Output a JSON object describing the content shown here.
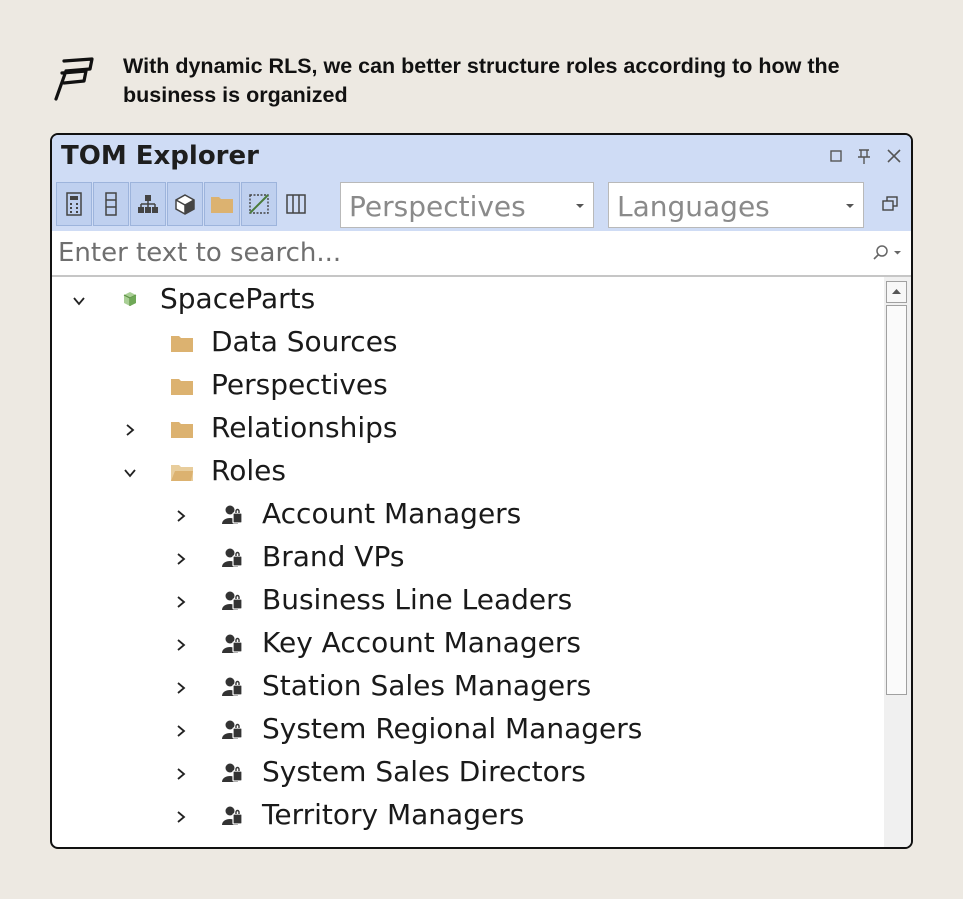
{
  "caption": "With dynamic RLS, we can better structure roles according to how the business is organized",
  "window": {
    "title": "TOM Explorer",
    "controls": [
      "maximize-icon",
      "pin-icon",
      "close-icon"
    ]
  },
  "toolbar": {
    "buttons": [
      "calculator-icon",
      "column-icon",
      "hierarchy-icon",
      "cube-icon",
      "folder-icon",
      "hidden-icon",
      "columns-icon"
    ],
    "perspectives": "Perspectives",
    "languages": "Languages",
    "window_icon": "window-copy-icon"
  },
  "search": {
    "placeholder": "Enter text to search...",
    "icon": "search-icon"
  },
  "tree": {
    "model": {
      "label": "SpaceParts",
      "icon": "model-icon",
      "expanded": true
    },
    "folders": [
      {
        "label": "Data Sources",
        "icon": "folder-icon",
        "expanded": false
      },
      {
        "label": "Perspectives",
        "icon": "folder-icon",
        "expanded": false
      },
      {
        "label": "Relationships",
        "icon": "folder-icon",
        "expanded": false
      },
      {
        "label": "Roles",
        "icon": "folder-open-icon",
        "expanded": true
      }
    ],
    "roles": [
      {
        "label": "Account Managers",
        "icon": "role-icon"
      },
      {
        "label": "Brand VPs",
        "icon": "role-icon"
      },
      {
        "label": "Business Line Leaders",
        "icon": "role-icon"
      },
      {
        "label": "Key Account Managers",
        "icon": "role-icon"
      },
      {
        "label": "Station Sales Managers",
        "icon": "role-icon"
      },
      {
        "label": "System Regional Managers",
        "icon": "role-icon"
      },
      {
        "label": "System Sales Directors",
        "icon": "role-icon"
      },
      {
        "label": "Territory Managers",
        "icon": "role-icon"
      }
    ]
  },
  "colors": {
    "titlebar": "#cfdcf5",
    "folder": "#dcb270",
    "background": "#ede9e2"
  }
}
